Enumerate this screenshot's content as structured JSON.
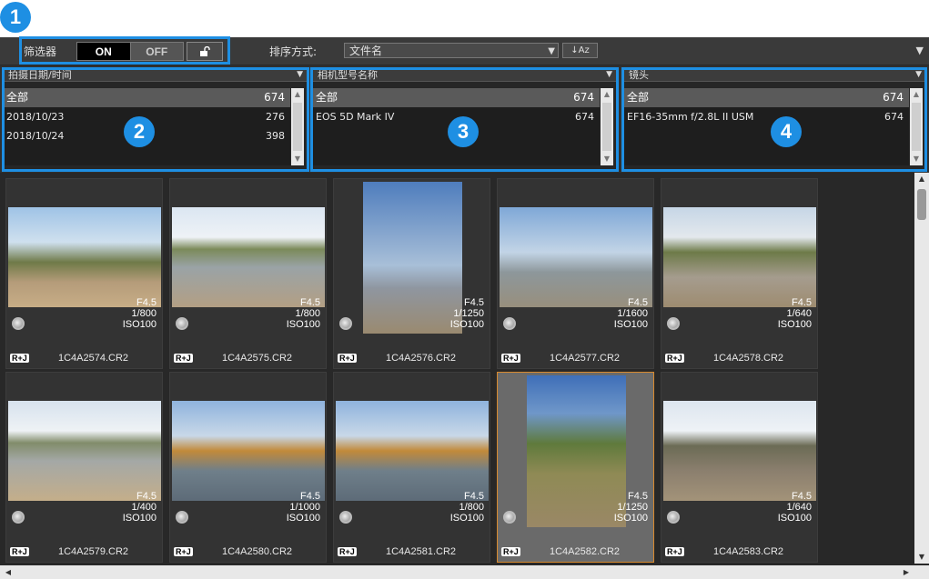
{
  "callouts": [
    "1",
    "2",
    "3",
    "4"
  ],
  "toolbar": {
    "filter_label": "筛选器",
    "on_label": "ON",
    "off_label": "OFF",
    "sort_label": "排序方式:",
    "sort_value": "文件名",
    "sort_button": "↓Az"
  },
  "filters": [
    {
      "header": "拍摄日期/时间",
      "rows": [
        {
          "label": "全部",
          "count": "674"
        },
        {
          "label": "2018/10/23",
          "count": "276"
        },
        {
          "label": "2018/10/24",
          "count": "398"
        }
      ]
    },
    {
      "header": "相机型号名称",
      "rows": [
        {
          "label": "全部",
          "count": "674"
        },
        {
          "label": "EOS 5D Mark IV",
          "count": "674"
        }
      ]
    },
    {
      "header": "镜头",
      "rows": [
        {
          "label": "全部",
          "count": "674"
        },
        {
          "label": "EF16-35mm f/2.8L II USM",
          "count": "674"
        }
      ]
    }
  ],
  "thumbnails": [
    {
      "file": "1C4A2574.CR2",
      "aperture": "F4.5",
      "shutter": "1/800",
      "iso": "ISO100",
      "tag": "R+J"
    },
    {
      "file": "1C4A2575.CR2",
      "aperture": "F4.5",
      "shutter": "1/800",
      "iso": "ISO100",
      "tag": "R+J"
    },
    {
      "file": "1C4A2576.CR2",
      "aperture": "F4.5",
      "shutter": "1/1250",
      "iso": "ISO100",
      "tag": "R+J"
    },
    {
      "file": "1C4A2577.CR2",
      "aperture": "F4.5",
      "shutter": "1/1600",
      "iso": "ISO100",
      "tag": "R+J"
    },
    {
      "file": "1C4A2578.CR2",
      "aperture": "F4.5",
      "shutter": "1/640",
      "iso": "ISO100",
      "tag": "R+J"
    },
    {
      "file": "1C4A2579.CR2",
      "aperture": "F4.5",
      "shutter": "1/400",
      "iso": "ISO100",
      "tag": "R+J"
    },
    {
      "file": "1C4A2580.CR2",
      "aperture": "F4.5",
      "shutter": "1/1000",
      "iso": "ISO100",
      "tag": "R+J"
    },
    {
      "file": "1C4A2581.CR2",
      "aperture": "F4.5",
      "shutter": "1/800",
      "iso": "ISO100",
      "tag": "R+J"
    },
    {
      "file": "1C4A2582.CR2",
      "aperture": "F4.5",
      "shutter": "1/1250",
      "iso": "ISO100",
      "tag": "R+J"
    },
    {
      "file": "1C4A2583.CR2",
      "aperture": "F4.5",
      "shutter": "1/640",
      "iso": "ISO100",
      "tag": "R+J"
    }
  ],
  "icons": {
    "lock": "unlock-icon",
    "dropdown": "chevron-down-icon",
    "rating": "rating-icon"
  },
  "colors": {
    "accent": "#1e8fe3",
    "selection_border": "#d88a2e"
  }
}
